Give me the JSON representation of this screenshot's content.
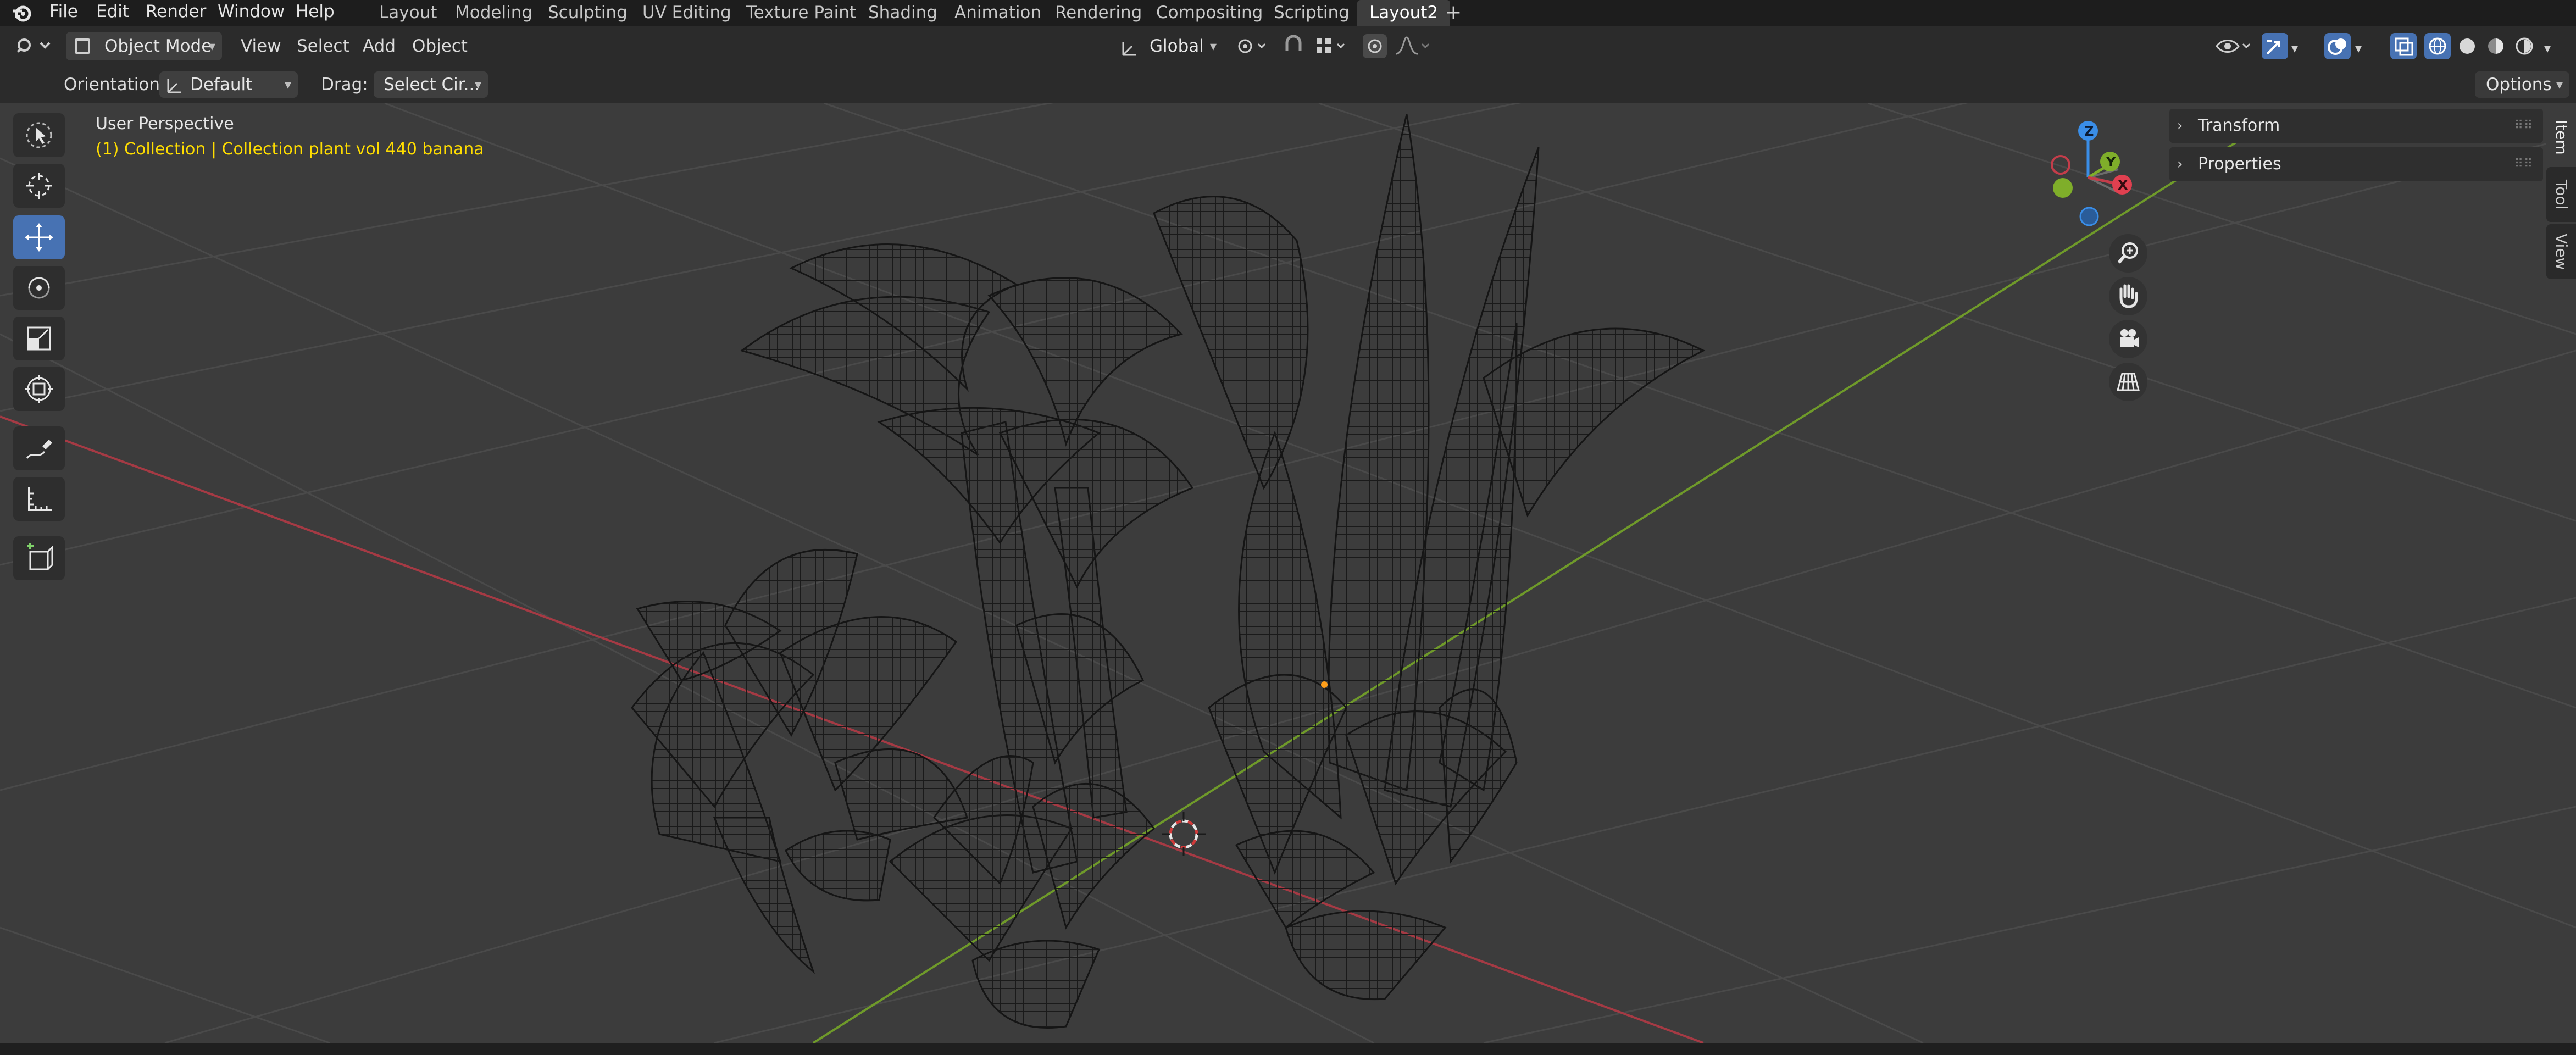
{
  "menu": [
    "File",
    "Edit",
    "Render",
    "Window",
    "Help"
  ],
  "workspaces": [
    "Layout",
    "Modeling",
    "Sculpting",
    "UV Editing",
    "Texture Paint",
    "Shading",
    "Animation",
    "Rendering",
    "Compositing",
    "Scripting",
    "Layout2"
  ],
  "header": {
    "mode": "Object Mode",
    "menus": [
      "View",
      "Select",
      "Add",
      "Object"
    ],
    "transform_orientation": "Global",
    "options_label": "Options"
  },
  "toolsettings": {
    "orientation_label": "Orientation:",
    "orientation_value": "Default",
    "drag_label": "Drag:",
    "drag_value": "Select Cir..."
  },
  "viewport": {
    "view_name": "User Perspective",
    "collection_info": "(1) Collection | Collection plant vol 440 banana"
  },
  "gizmo": {
    "z": "Z",
    "y": "Y",
    "x": "X"
  },
  "npanel": {
    "sections": [
      "Transform",
      "Properties"
    ],
    "tabs": [
      "Item",
      "Tool",
      "View"
    ]
  },
  "colors": {
    "accent": "#4772b3",
    "active_text": "#ffdd00",
    "x_axis": "#c43d4a",
    "y_axis": "#7fae2a",
    "z_axis": "#3a8ee8"
  }
}
